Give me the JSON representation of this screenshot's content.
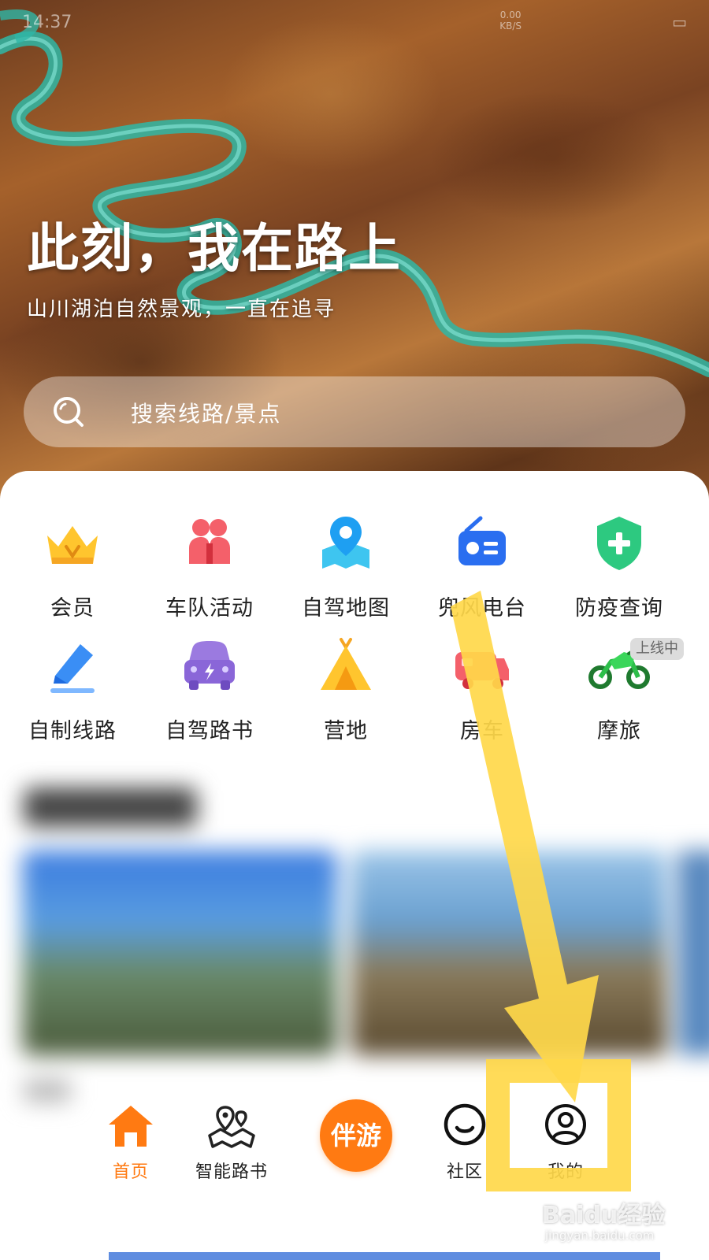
{
  "status": {
    "time": "14:37",
    "net_speed": "0.00\nKB/S"
  },
  "hero": {
    "title": "此刻，我在路上",
    "subtitle": "山川湖泊自然景观，一直在追寻"
  },
  "search": {
    "placeholder": "搜索线路/景点"
  },
  "services": [
    {
      "label": "会员",
      "icon": "crown-icon"
    },
    {
      "label": "车队活动",
      "icon": "group-icon"
    },
    {
      "label": "自驾地图",
      "icon": "map-pin-icon"
    },
    {
      "label": "兜风电台",
      "icon": "radio-icon"
    },
    {
      "label": "防疫查询",
      "icon": "shield-plus-icon"
    },
    {
      "label": "自制线路",
      "icon": "pencil-icon"
    },
    {
      "label": "自驾路书",
      "icon": "car-icon"
    },
    {
      "label": "营地",
      "icon": "tent-icon"
    },
    {
      "label": "房车",
      "icon": "rv-icon"
    },
    {
      "label": "摩旅",
      "icon": "motorcycle-icon"
    }
  ],
  "badge": "上线中",
  "nav": {
    "home": "首页",
    "roadbook": "智能路书",
    "center": "伴游",
    "community": "社区",
    "mine": "我的"
  },
  "watermark": {
    "brand": "Baidu经验",
    "url": "jingyan.baidu.com"
  },
  "colors": {
    "accent": "#ff7a12",
    "annotation": "#ffd84a"
  }
}
